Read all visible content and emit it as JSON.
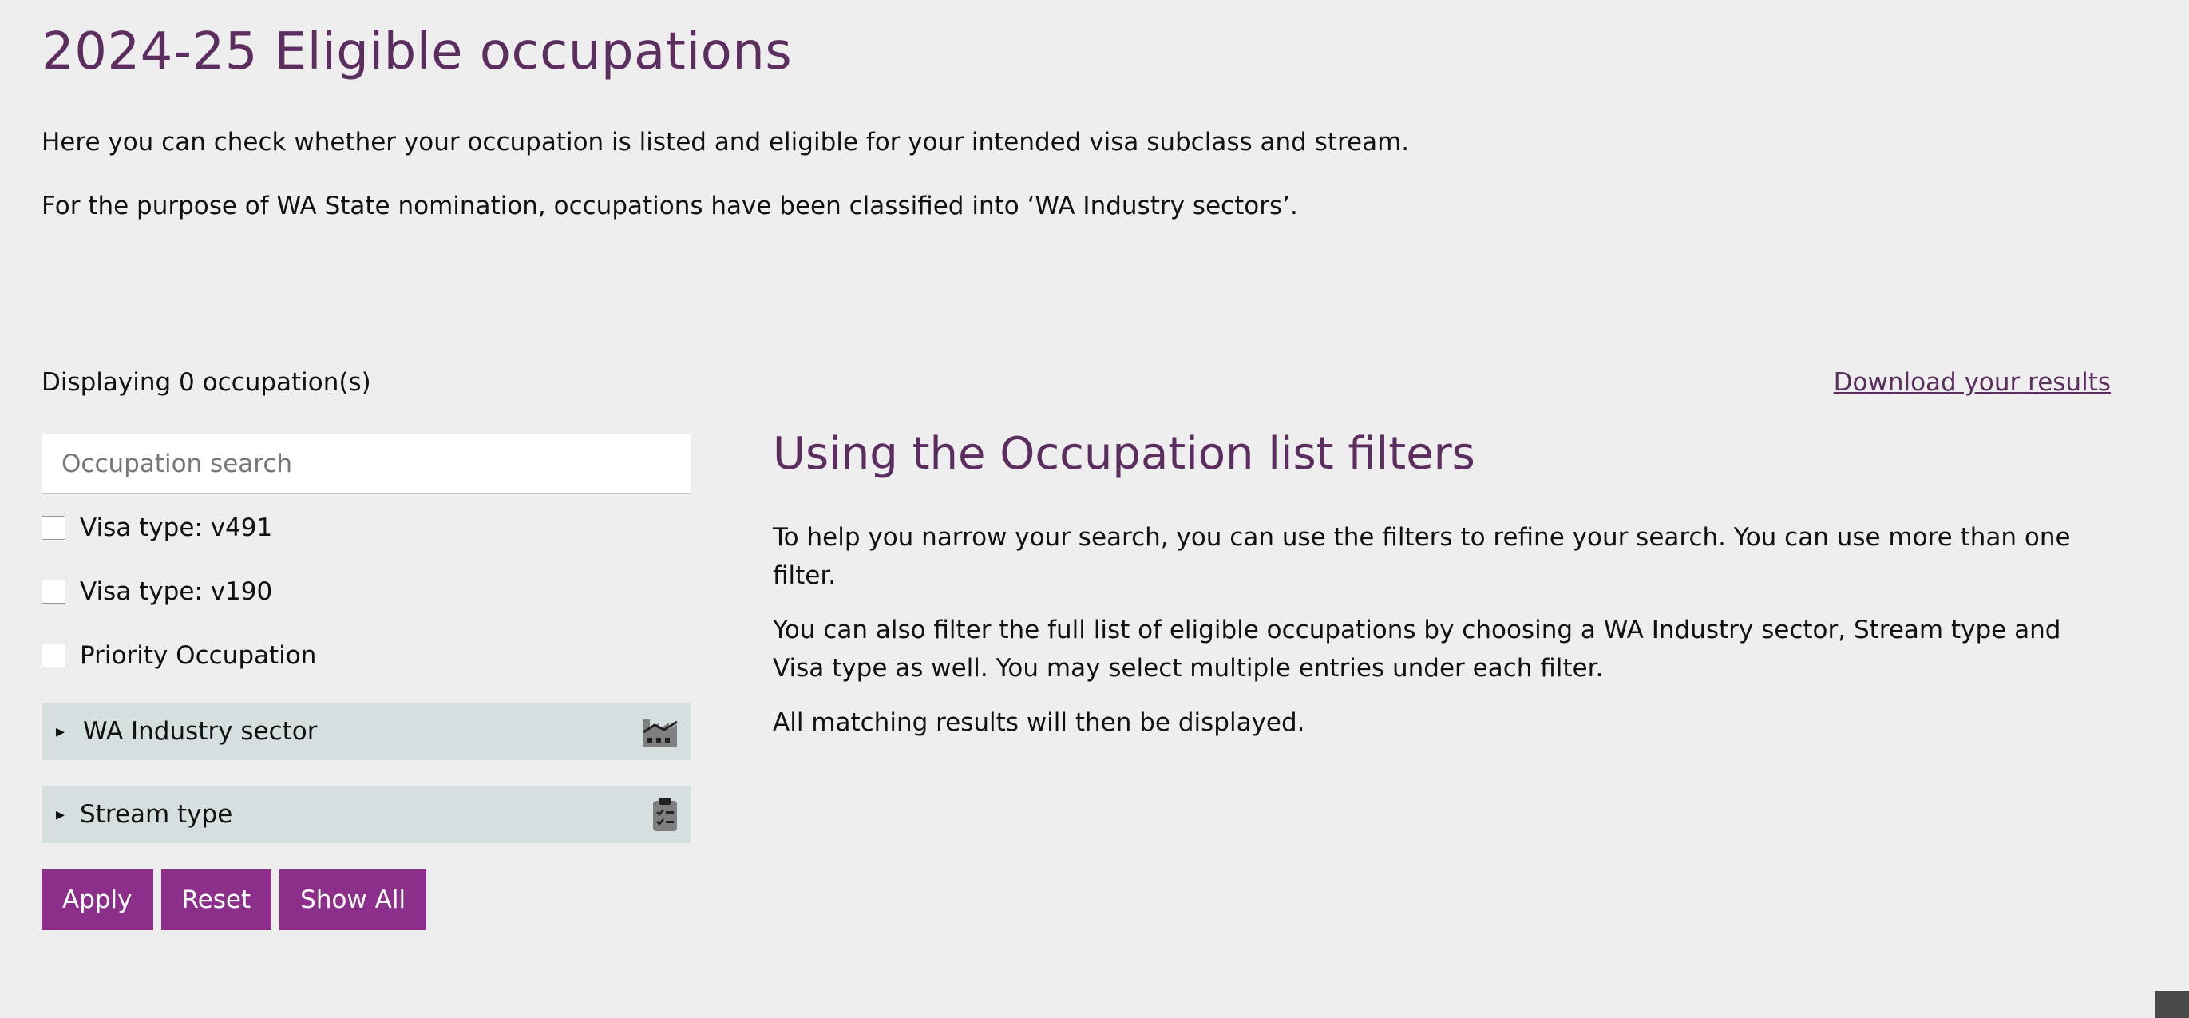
{
  "page": {
    "title": "2024-25 Eligible occupations",
    "intro": [
      "Here you can check whether your occupation is listed and eligible for your intended visa subclass and stream.",
      "For the purpose of WA State nomination, occupations have been classified into ‘WA Industry sectors’."
    ]
  },
  "results": {
    "count_text": "Displaying 0 occupation(s)",
    "download_label": "Download your results"
  },
  "filters": {
    "search_placeholder": "Occupation search",
    "search_value": "",
    "checkboxes": [
      {
        "label": "Visa type: v491",
        "checked": false
      },
      {
        "label": "Visa type: v190",
        "checked": false
      },
      {
        "label": "Priority Occupation",
        "checked": false
      }
    ],
    "accordions": [
      {
        "label": "WA Industry sector",
        "icon": "factory-icon",
        "caret": "▸"
      },
      {
        "label": "Stream type",
        "icon": "clipboard-checklist-icon",
        "caret": "▸"
      }
    ],
    "buttons": {
      "apply": "Apply",
      "reset": "Reset",
      "show_all": "Show All"
    }
  },
  "help": {
    "title": "Using the Occupation list filters",
    "paragraphs": [
      "To help you narrow your search, you can use the filters to refine your search. You can use more than one filter.",
      "You can also filter the full list of eligible occupations by choosing a WA Industry sector, Stream type and Visa type as well. You may select multiple entries under each filter.",
      "All matching results will then be displayed."
    ]
  },
  "colors": {
    "background": "#eeeeee",
    "heading": "#5c2d5f",
    "button": "#8b2f8a",
    "accordion": "#d6dfe0",
    "icon": "#808080"
  }
}
